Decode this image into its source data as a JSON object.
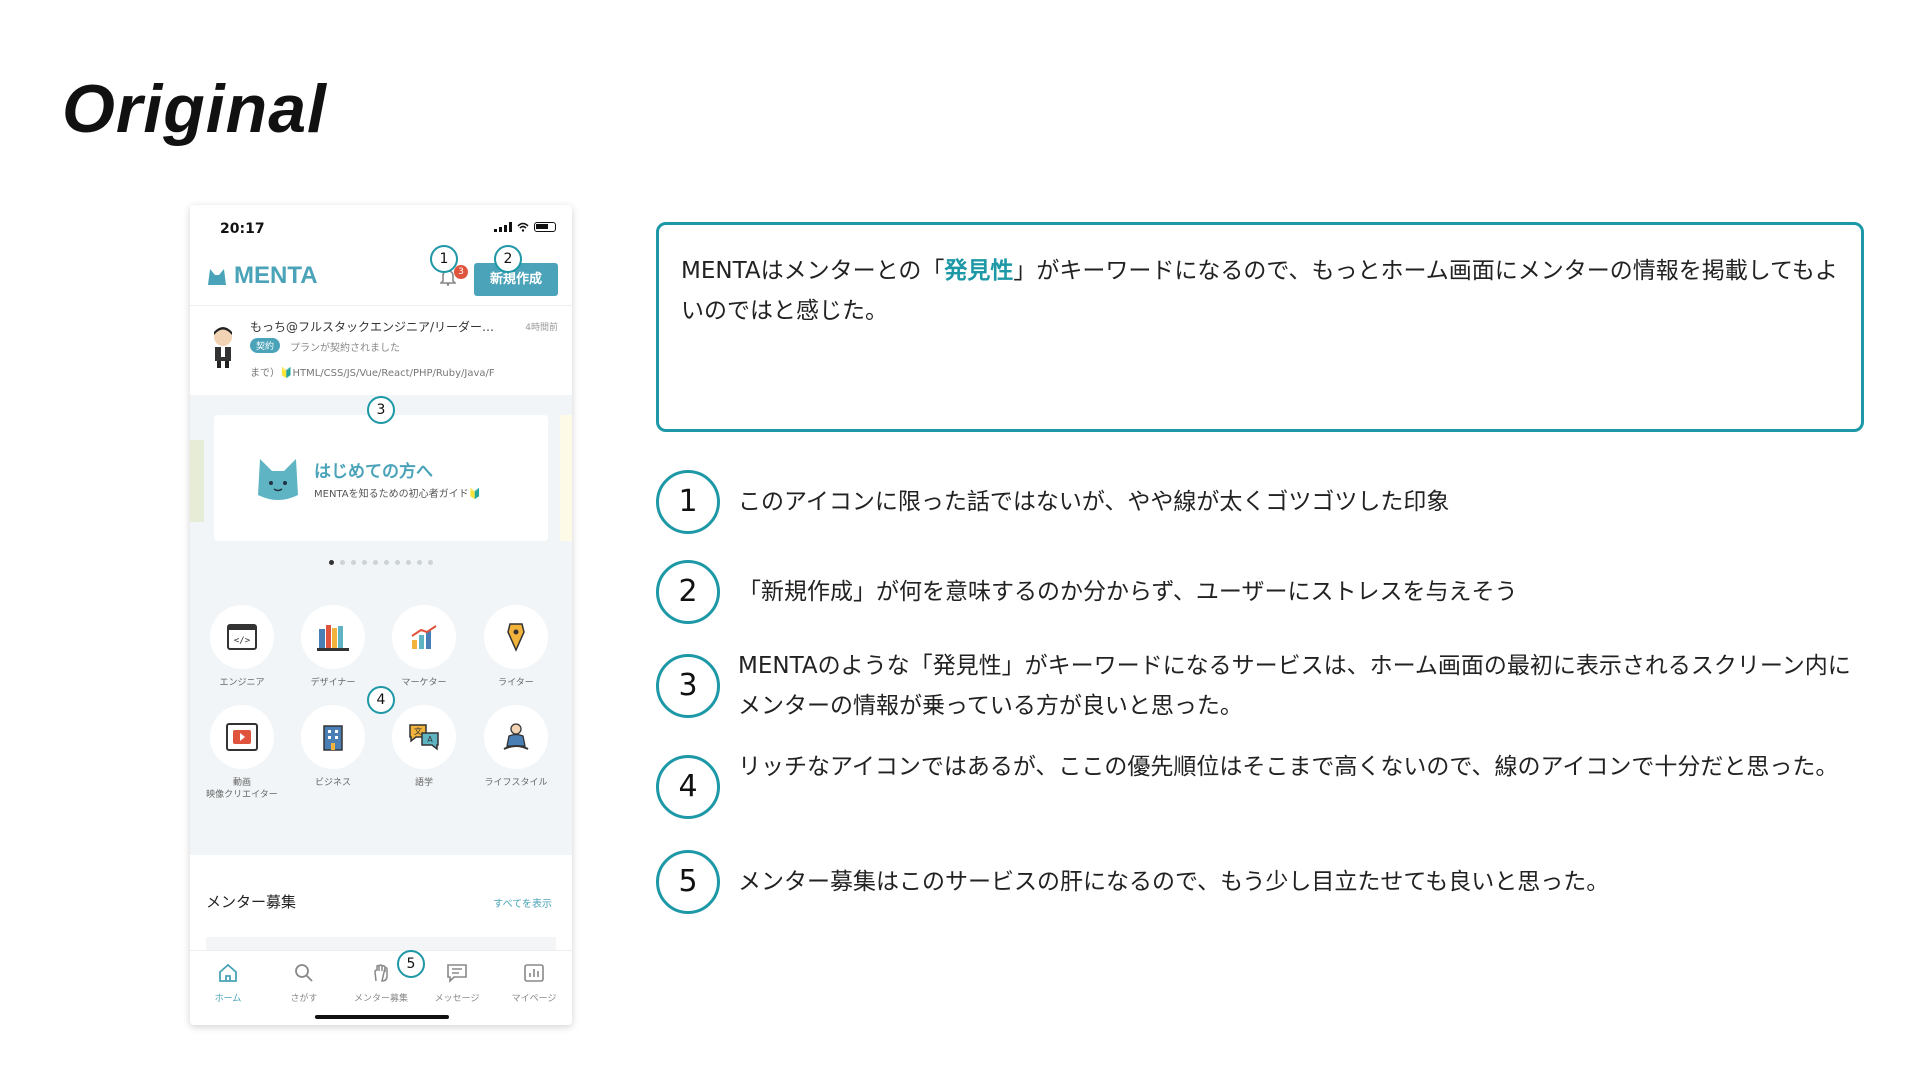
{
  "heading": "Original",
  "phone": {
    "time": "20:17",
    "logo": "MENTA",
    "bell_badge": "3",
    "new_button": "新規作成",
    "notice": {
      "name": "もっち@フルスタックエンジニア/リーダー…",
      "ago": "4時間前",
      "tag": "契約",
      "message": "プランが契約されました",
      "skills": "まで）🔰HTML/CSS/JS/Vue/React/PHP/Ruby/Java/F"
    },
    "banner": {
      "title": "はじめての方へ",
      "subtitle": "MENTAを知るための初心者ガイド🔰"
    },
    "categories": [
      {
        "label": "エンジニア",
        "icon": "code-icon"
      },
      {
        "label": "デザイナー",
        "icon": "books-icon"
      },
      {
        "label": "マーケター",
        "icon": "chart-icon"
      },
      {
        "label": "ライター",
        "icon": "pen-icon"
      },
      {
        "label": "動画\n映像クリエイター",
        "icon": "video-icon"
      },
      {
        "label": "ビジネス",
        "icon": "building-icon"
      },
      {
        "label": "語学",
        "icon": "language-icon"
      },
      {
        "label": "ライフスタイル",
        "icon": "meditation-icon"
      }
    ],
    "mentor_section": {
      "title": "メンター募集",
      "see_all": "すべてを表示"
    },
    "tabs": [
      {
        "label": "ホーム",
        "icon": "home-icon"
      },
      {
        "label": "さがす",
        "icon": "search-icon"
      },
      {
        "label": "メンター募集",
        "icon": "hand-icon"
      },
      {
        "label": "メッセージ",
        "icon": "message-icon"
      },
      {
        "label": "マイページ",
        "icon": "chart-icon"
      }
    ]
  },
  "markers": [
    "1",
    "2",
    "3",
    "4",
    "5"
  ],
  "summary": {
    "before": "MENTAはメンターとの「",
    "highlight": "発見性",
    "after": "」がキーワードになるので、もっとホーム画面にメンターの情報を掲載してもよいのではと感じた。"
  },
  "points": [
    {
      "num": "1",
      "text": "このアイコンに限った話ではないが、やや線が太くゴツゴツした印象"
    },
    {
      "num": "2",
      "text": "「新規作成」が何を意味するのか分からず、ユーザーにストレスを与えそう"
    },
    {
      "num": "3",
      "text": "MENTAのような「発見性」がキーワードになるサービスは、ホーム画面の最初に表示されるスクリーン内にメンターの情報が乗っている方が良いと思った。"
    },
    {
      "num": "4",
      "text": "リッチなアイコンではあるが、ここの優先順位はそこまで高くないので、線のアイコンで十分だと思った。"
    },
    {
      "num": "5",
      "text": "メンター募集はこのサービスの肝になるので、もう少し目立たせても良いと思った。"
    }
  ],
  "colors": {
    "accent": "#1d98a6",
    "brand": "#4aa3b8"
  }
}
